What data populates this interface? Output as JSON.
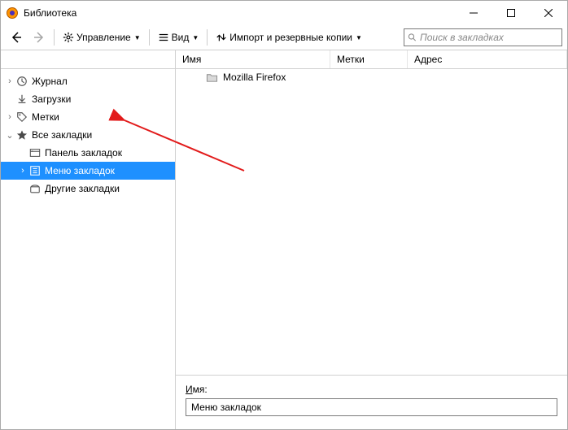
{
  "titlebar": {
    "title": "Библиотека"
  },
  "toolbar": {
    "manage_label": "Управление",
    "view_label": "Вид",
    "import_label": "Импорт и резервные копии",
    "search_placeholder": "Поиск в закладках"
  },
  "columns": {
    "name": "Имя",
    "tags": "Метки",
    "address": "Адрес"
  },
  "tree": {
    "history": "Журнал",
    "downloads": "Загрузки",
    "tags": "Метки",
    "all_bookmarks": "Все закладки",
    "bookmarks_toolbar": "Панель закладок",
    "bookmarks_menu": "Меню закладок",
    "other_bookmarks": "Другие закладки"
  },
  "list": {
    "items": [
      {
        "label": "Mozilla Firefox"
      }
    ]
  },
  "details": {
    "name_label_u": "И",
    "name_label_rest": "мя:",
    "name_value": "Меню закладок"
  }
}
